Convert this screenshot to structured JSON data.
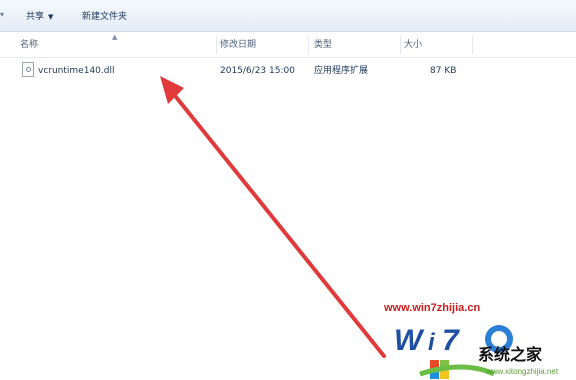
{
  "toolbar": {
    "share_label": "共享",
    "share_caret": "▼",
    "new_folder_label": "新建文件夹"
  },
  "columns": {
    "name": "名称",
    "modified": "修改日期",
    "type": "类型",
    "size": "大小"
  },
  "files": [
    {
      "name": "vcruntime140.dll",
      "modified": "2015/6/23 15:00",
      "type": "应用程序扩展",
      "size": "87 KB"
    }
  ],
  "watermark": {
    "url": "www.win7zhijia.cn",
    "site_name": "系统之家",
    "sub_text": "www.xitongzhijia.net"
  },
  "colors": {
    "arrow": "#e03a3a",
    "watermark_url": "#c61d1d"
  },
  "icons": {
    "file": "dll-file-icon",
    "sort": "sort-up-icon"
  }
}
